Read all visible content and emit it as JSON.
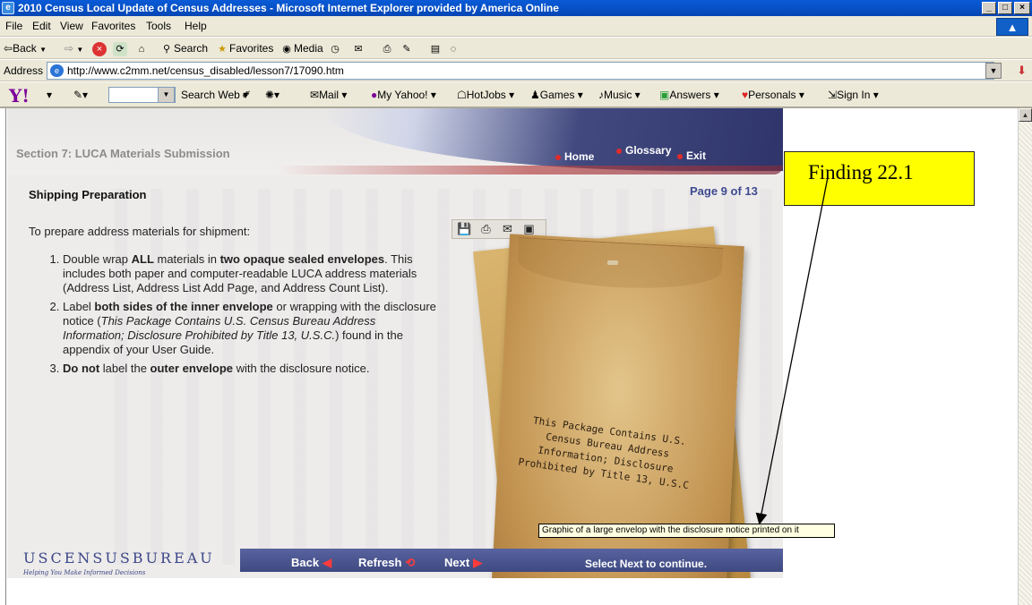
{
  "window": {
    "title": "2010 Census Local Update of Census Addresses - Microsoft Internet Explorer provided by America Online"
  },
  "menu": [
    "File",
    "Edit",
    "View",
    "Favorites",
    "Tools",
    "Help"
  ],
  "toolbar": {
    "back": "Back",
    "search": "Search",
    "favorites": "Favorites",
    "media": "Media"
  },
  "address": {
    "label": "Address",
    "url": "http://www.c2mm.net/census_disabled/lesson7/17090.htm"
  },
  "yahoo": {
    "logo": "Y!",
    "search_web": "Search Web",
    "items": [
      "Mail",
      "My Yahoo!",
      "HotJobs",
      "Games",
      "Music",
      "Answers",
      "Personals",
      "Sign In"
    ]
  },
  "lesson": {
    "section_title": "Section 7: LUCA Materials Submission",
    "nav": [
      "Home",
      "Glossary",
      "Exit"
    ],
    "heading": "Shipping Preparation",
    "page_indicator": "Page 9 of 13",
    "intro": "To prepare address materials for shipment:",
    "envelope_text": "This Package Contains U.S. Census Bureau Address Information; Disclosure Prohibited by Title 13, U.S.C",
    "bureau_name": "USCENSUSBUREAU",
    "bureau_tagline": "Helping You Make Informed Decisions",
    "footer": {
      "back": "Back",
      "refresh": "Refresh",
      "next": "Next",
      "instruction": "Select Next to continue."
    },
    "tooltip": "Graphic of a large envelop with the disclosure notice printed on it"
  },
  "steps": {
    "s1": {
      "a": "Double wrap ",
      "b": "ALL",
      "c": " materials in ",
      "d": "two opaque sealed envelopes",
      "e": ". This includes both paper and computer-readable LUCA address materials (Address List, Address List Add Page, and Address Count List)."
    },
    "s2": {
      "a": "Label ",
      "b": "both sides of the inner envelope",
      "c": " or wrapping with the disclosure notice (",
      "d": "This Package Contains U.S. Census Bureau Address Information; Disclosure Prohibited by Title 13, U.S.C.",
      "e": ") found in the appendix of your User Guide."
    },
    "s3": {
      "a": "Do not",
      "b": " label the ",
      "c": "outer envelope",
      "d": " with the disclosure notice."
    }
  },
  "callout": {
    "text": "Finding 22.1"
  }
}
